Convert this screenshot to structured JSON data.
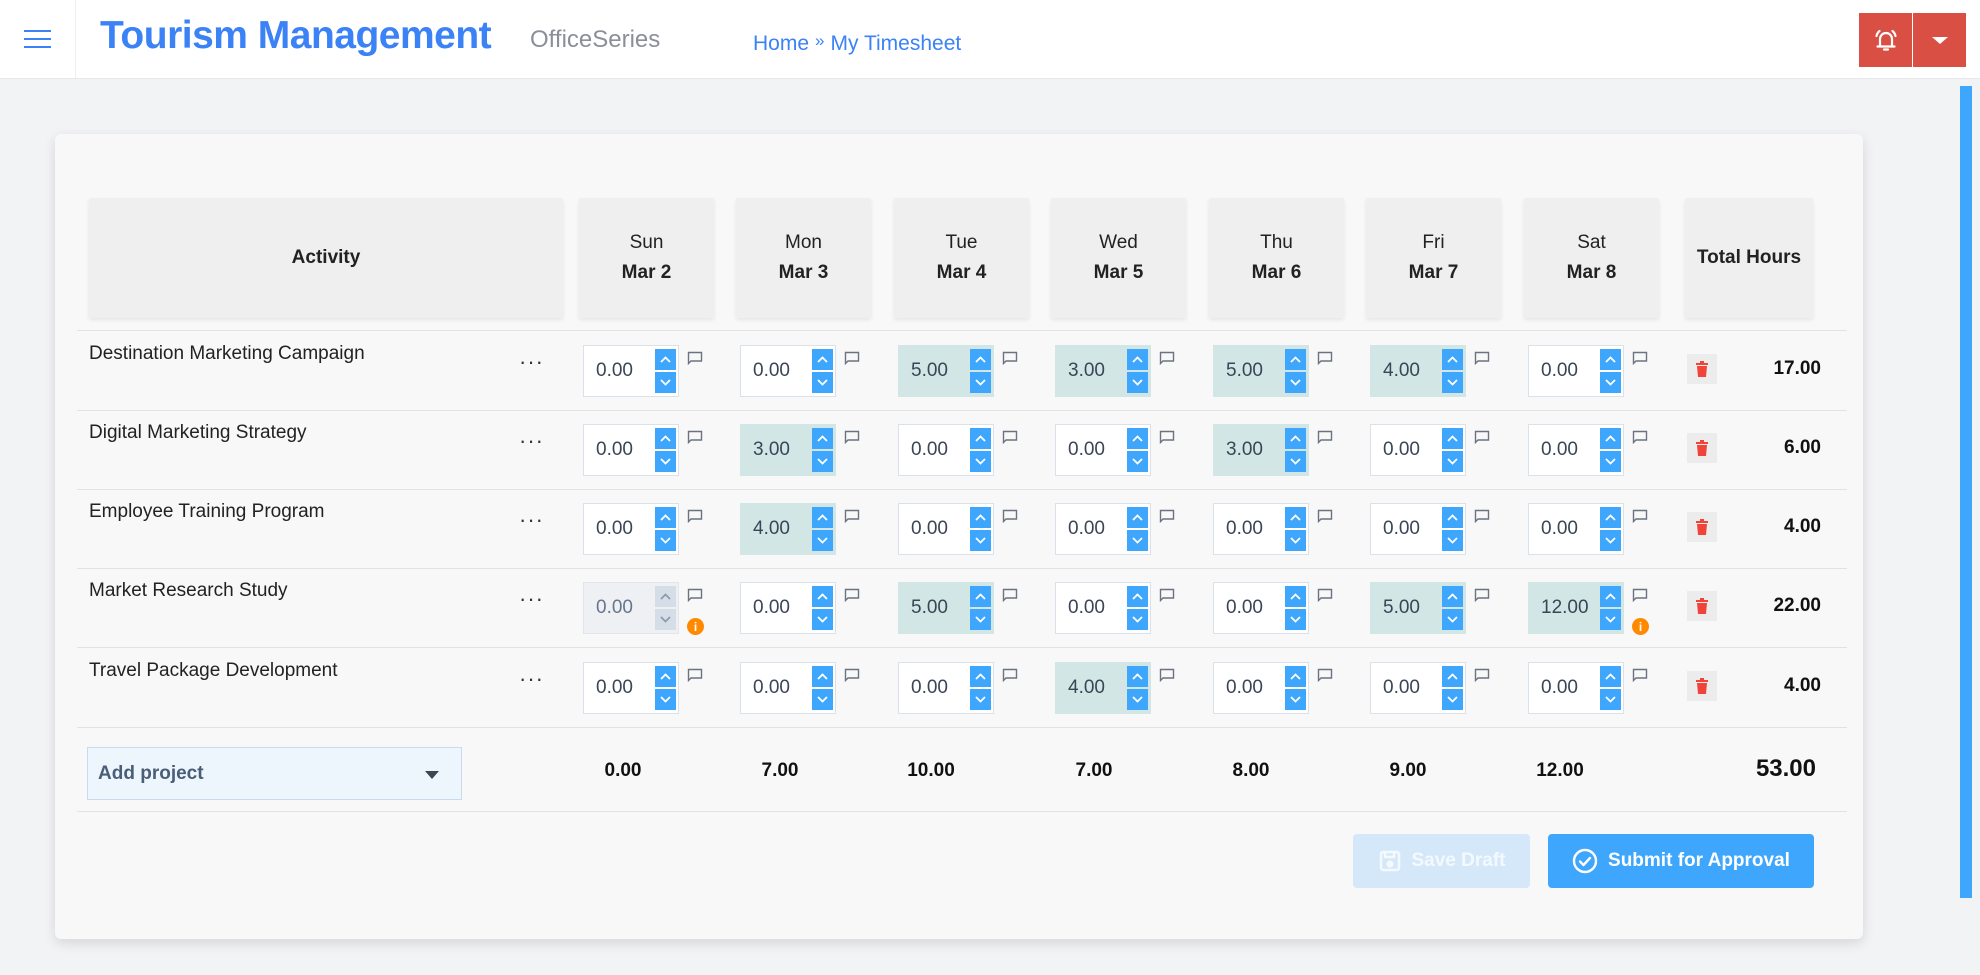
{
  "header": {
    "app_title": "Tourism Management",
    "app_subtitle": "OfficeSeries",
    "breadcrumb": [
      {
        "label": "Home"
      },
      {
        "label": "My Timesheet"
      }
    ],
    "breadcrumb_separator": "»",
    "icons": {
      "menu": "hamburger-icon",
      "alerts": "bell-ringing-icon",
      "dropdown": "caret-down-icon"
    },
    "accent_color": "#3b82f6",
    "alert_button_color": "#d94f43"
  },
  "table": {
    "activity_header": "Activity",
    "total_header": "Total Hours",
    "days": [
      {
        "day": "Sun",
        "date": "Mar 2"
      },
      {
        "day": "Mon",
        "date": "Mar 3"
      },
      {
        "day": "Tue",
        "date": "Mar 4"
      },
      {
        "day": "Wed",
        "date": "Mar 5"
      },
      {
        "day": "Thu",
        "date": "Mar 6"
      },
      {
        "day": "Fri",
        "date": "Mar 7"
      },
      {
        "day": "Sat",
        "date": "Mar 8"
      }
    ],
    "rows": [
      {
        "activity": "Destination Marketing Campaign",
        "more_label": "···",
        "hours": [
          "0.00",
          "0.00",
          "5.00",
          "3.00",
          "5.00",
          "4.00",
          "0.00"
        ],
        "disabled": [
          false,
          false,
          false,
          false,
          false,
          false,
          false
        ],
        "info": [
          false,
          false,
          false,
          false,
          false,
          false,
          false
        ],
        "total": "17.00"
      },
      {
        "activity": "Digital Marketing Strategy",
        "more_label": "···",
        "hours": [
          "0.00",
          "3.00",
          "0.00",
          "0.00",
          "3.00",
          "0.00",
          "0.00"
        ],
        "disabled": [
          false,
          false,
          false,
          false,
          false,
          false,
          false
        ],
        "info": [
          false,
          false,
          false,
          false,
          false,
          false,
          false
        ],
        "total": "6.00"
      },
      {
        "activity": "Employee Training Program",
        "more_label": "···",
        "hours": [
          "0.00",
          "4.00",
          "0.00",
          "0.00",
          "0.00",
          "0.00",
          "0.00"
        ],
        "disabled": [
          false,
          false,
          false,
          false,
          false,
          false,
          false
        ],
        "info": [
          false,
          false,
          false,
          false,
          false,
          false,
          false
        ],
        "total": "4.00"
      },
      {
        "activity": "Market Research Study",
        "more_label": "···",
        "hours": [
          "0.00",
          "0.00",
          "5.00",
          "0.00",
          "0.00",
          "5.00",
          "12.00"
        ],
        "disabled": [
          true,
          false,
          false,
          false,
          false,
          false,
          false
        ],
        "info": [
          true,
          false,
          false,
          false,
          false,
          false,
          true
        ],
        "total": "22.00"
      },
      {
        "activity": "Travel Package Development",
        "more_label": "···",
        "hours": [
          "0.00",
          "0.00",
          "0.00",
          "4.00",
          "0.00",
          "0.00",
          "0.00"
        ],
        "disabled": [
          false,
          false,
          false,
          false,
          false,
          false,
          false
        ],
        "info": [
          false,
          false,
          false,
          false,
          false,
          false,
          false
        ],
        "total": "4.00"
      }
    ],
    "day_totals": [
      "0.00",
      "7.00",
      "10.00",
      "7.00",
      "8.00",
      "9.00",
      "12.00"
    ],
    "grand_total": "53.00",
    "info_glyph": "i",
    "filled_cell_color": "#d2e6e6",
    "spinner_color": "#3ea6fc",
    "delete_icon_color": "#f0443a",
    "warning_color": "#ff8a00"
  },
  "footer": {
    "add_project_label": "Add project",
    "save_draft_label": "Save Draft",
    "submit_label": "Submit for Approval",
    "save_draft_disabled": true
  }
}
